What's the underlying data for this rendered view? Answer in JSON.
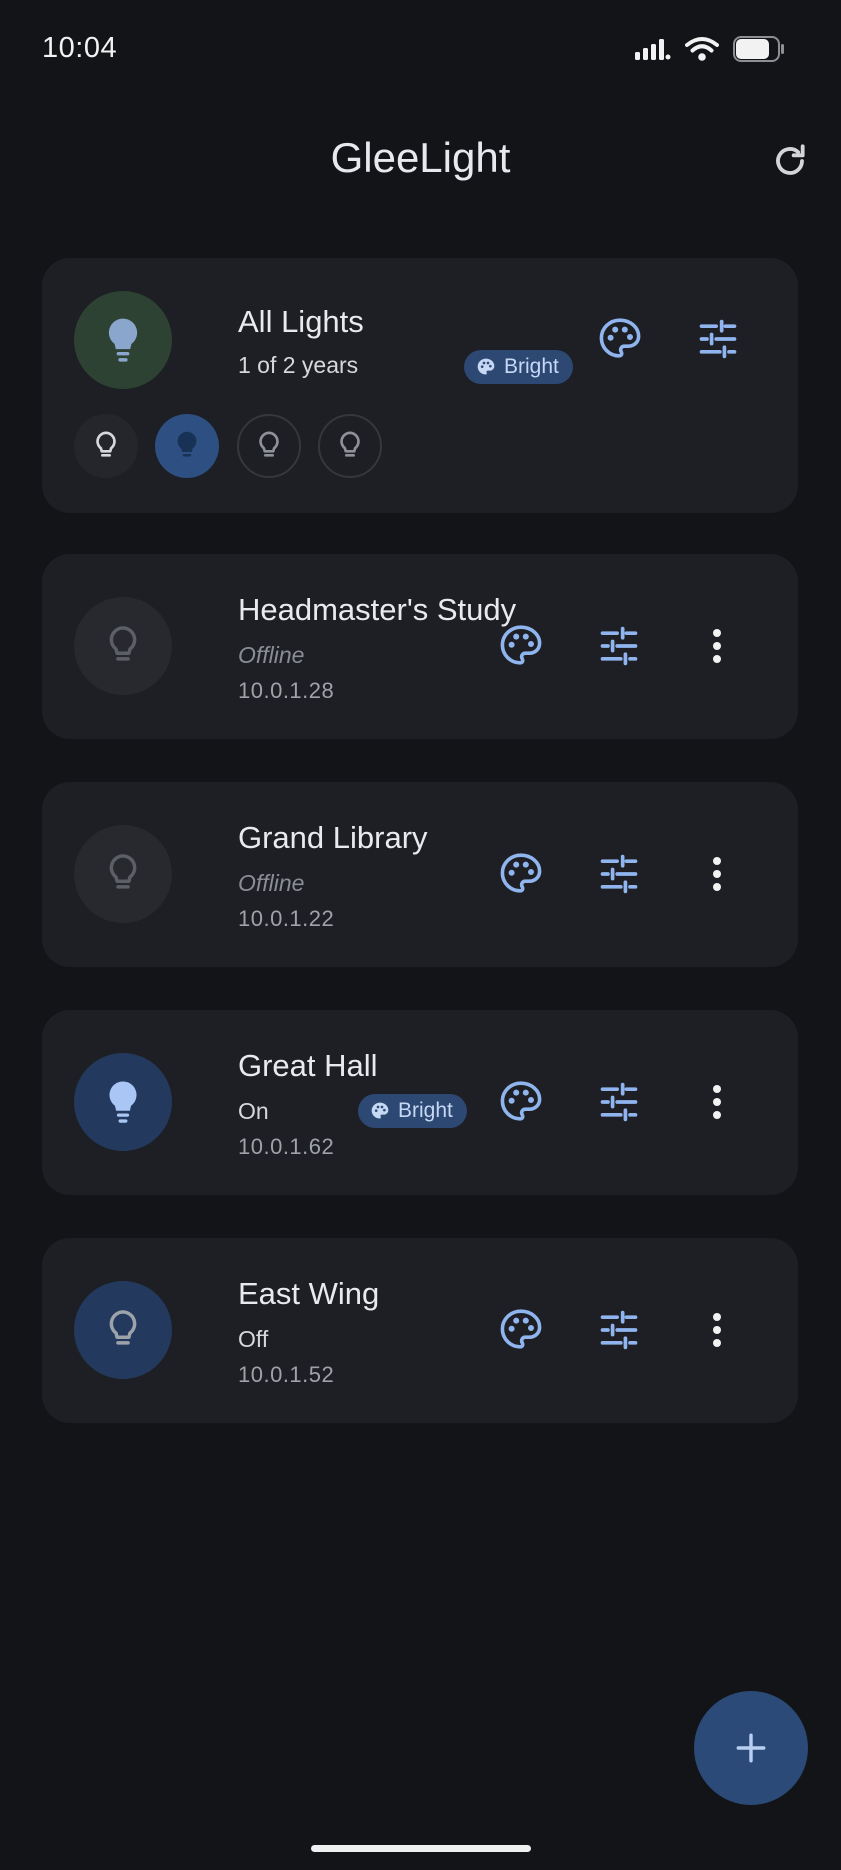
{
  "status_bar": {
    "time": "10:04"
  },
  "app": {
    "title": "GleeLight"
  },
  "group": {
    "name": "All Lights",
    "subtitle": "1 of 2 years",
    "chip_label": "Bright"
  },
  "devices": [
    {
      "name": "Headmaster's Study",
      "status": "Offline",
      "ip": "10.0.1.28"
    },
    {
      "name": "Grand Library",
      "status": "Offline",
      "ip": "10.0.1.22"
    },
    {
      "name": "Great Hall",
      "status": "On",
      "ip": "10.0.1.62",
      "chip_label": "Bright"
    },
    {
      "name": "East Wing",
      "status": "Off",
      "ip": "10.0.1.52"
    }
  ],
  "colors": {
    "background": "#121418",
    "card": "#1d1f24",
    "accent": "#8fb4ee",
    "chip": "#2c4873",
    "fab": "#2b4a78"
  },
  "icons": [
    "signal-icon",
    "wifi-icon",
    "battery-icon",
    "refresh-icon",
    "bulb-icon",
    "palette-icon",
    "sliders-icon",
    "more-vert-icon",
    "add-icon"
  ]
}
